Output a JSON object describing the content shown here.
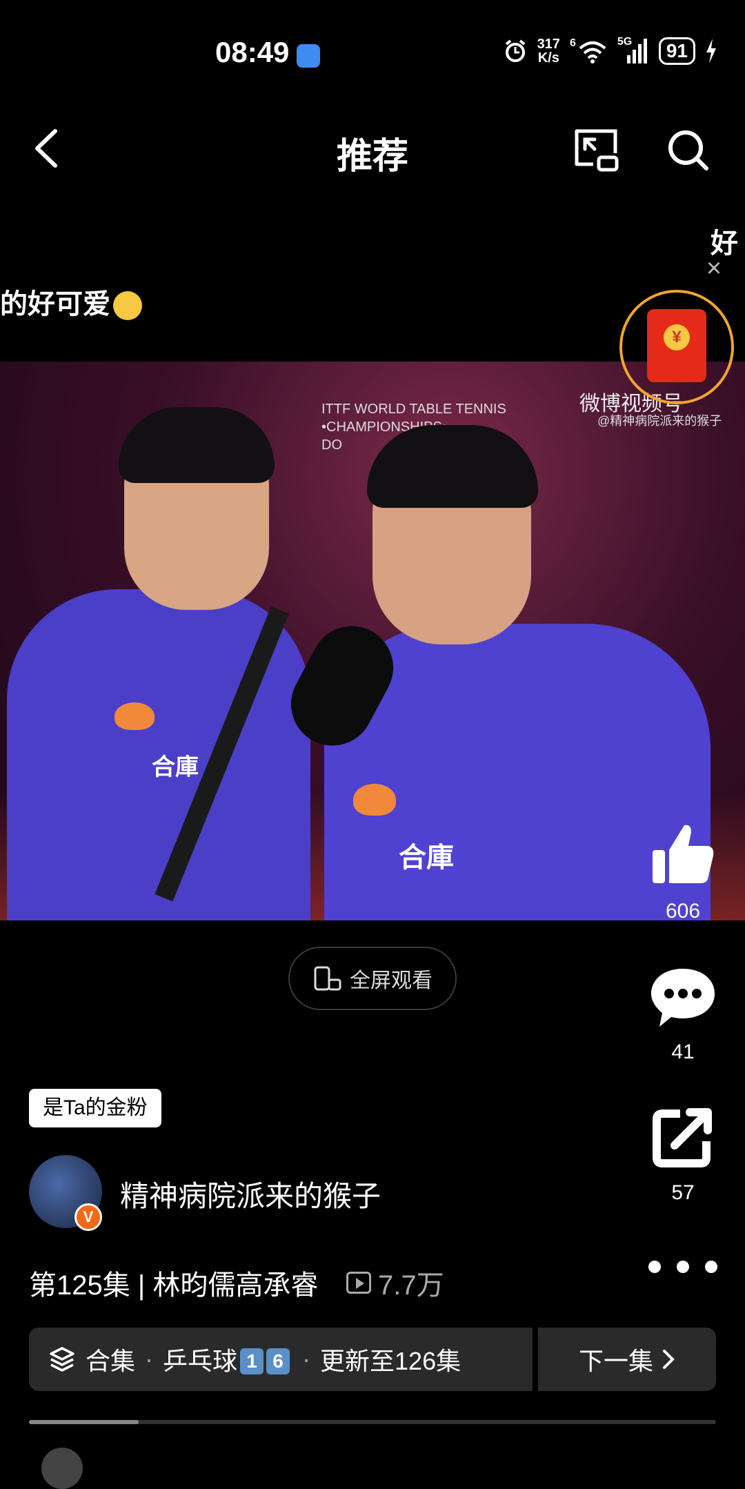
{
  "status_bar": {
    "time": "08:49",
    "net_speed_value": "317",
    "net_speed_unit": "K/s",
    "wifi_level": "6",
    "network": "5G",
    "battery": "91"
  },
  "header": {
    "title": "推荐"
  },
  "danmaku": {
    "line1": "的好可爱",
    "line2": "好"
  },
  "red_packet": {
    "coin_symbol": "¥"
  },
  "video": {
    "watermark_event": "ITTF WORLD TABLE TENNIS\n•CHAMPIONSHIPS•\nDO",
    "watermark_brand": "微博视频号",
    "watermark_handle": "@精神病院派来的猴子",
    "jersey_text_left": "合庫",
    "jersey_text_right": "合庫"
  },
  "actions": {
    "like_count": "606",
    "comment_count": "41",
    "share_count": "57"
  },
  "fullscreen_label": "全屏观看",
  "author": {
    "fan_badge": "是Ta的金粉",
    "name": "精神病院派来的猴子",
    "verified_mark": "V"
  },
  "episode": {
    "title": "第125集 | 林昀儒高承睿",
    "play_count": "7.7万"
  },
  "collection": {
    "label": "合集",
    "topic": "乒乓球",
    "badge_digits": [
      "1",
      "6"
    ],
    "update_text": "更新至126集",
    "next_label": "下一集"
  },
  "progress": 0.16,
  "colors": {
    "background": "#000000",
    "red_packet": "#e62a1a",
    "red_packet_ring": "#f2a62e",
    "verified_badge": "#f06a1a",
    "number_badge": "#5b8fc7",
    "jersey": "#4b3fc8"
  }
}
